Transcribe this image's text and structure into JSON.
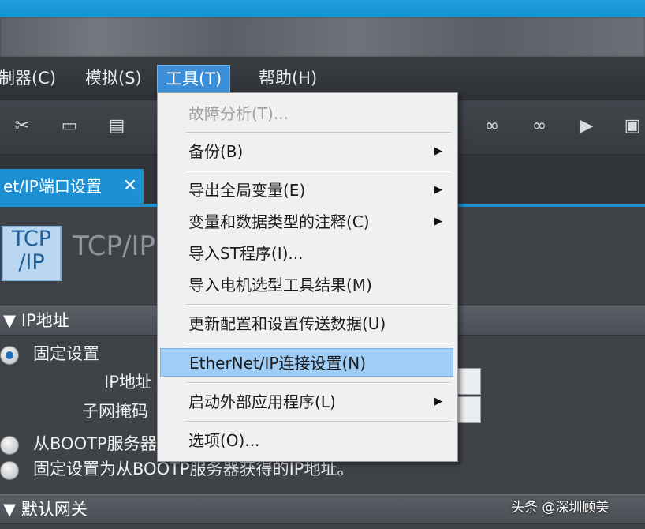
{
  "menubar": {
    "items": [
      {
        "label": "制器(C)"
      },
      {
        "label": "模拟(S)"
      },
      {
        "label": "工具(T)"
      },
      {
        "label": "帮助(H)"
      }
    ]
  },
  "tab": {
    "label": "et/IP端口设置",
    "close": "✕"
  },
  "logo": {
    "line1": "TCP",
    "line2": "/IP"
  },
  "page_title": "TCP/IP",
  "sections": {
    "ip_address": {
      "header": "▼ IP地址"
    },
    "gateway": {
      "header": "▼ 默认网关"
    }
  },
  "options": {
    "fixed": "固定设置",
    "ip_label": "IP地址",
    "subnet_label": "子网掩码",
    "bootp": "从BOOTP服务器",
    "fixed_bootp": "固定设置为从BOOTP服务器获得的IP地址。"
  },
  "tools_menu": {
    "items": [
      {
        "label": "故障分析(T)...",
        "disabled": true,
        "submenu": false
      },
      {
        "label": "备份(B)",
        "disabled": false,
        "submenu": true
      },
      {
        "label": "导出全局变量(E)",
        "disabled": false,
        "submenu": true
      },
      {
        "label": "变量和数据类型的注释(C)",
        "disabled": false,
        "submenu": true
      },
      {
        "label": "导入ST程序(I)...",
        "disabled": false,
        "submenu": false
      },
      {
        "label": "导入电机选型工具结果(M)",
        "disabled": false,
        "submenu": false
      },
      {
        "label": "更新配置和设置传送数据(U)",
        "disabled": false,
        "submenu": false
      },
      {
        "label": "EtherNet/IP连接设置(N)",
        "disabled": false,
        "submenu": false,
        "highlighted": true
      },
      {
        "label": "启动外部应用程序(L)",
        "disabled": false,
        "submenu": true
      },
      {
        "label": "选项(O)...",
        "disabled": false,
        "submenu": false
      }
    ],
    "submenu_arrow": "▶"
  },
  "watermark": "头条 @深圳顾美",
  "colors": {
    "accent": "#1d8fd3",
    "menu_highlight": "#9fcdf5",
    "titlebar": "#1fa0df"
  }
}
